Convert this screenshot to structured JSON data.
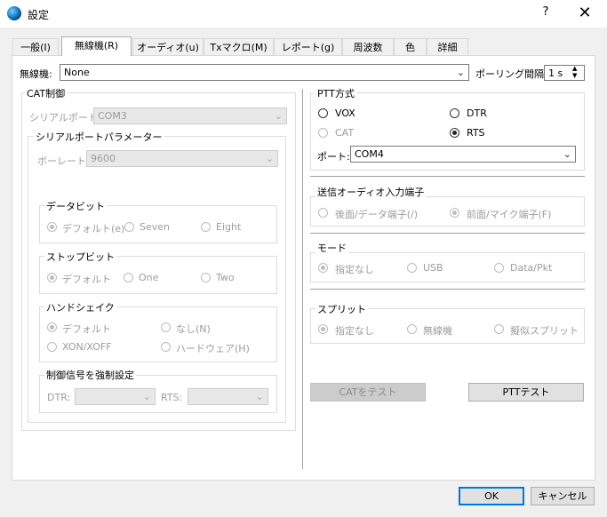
{
  "window": {
    "title": "設定",
    "help": "?",
    "close": "✕"
  },
  "tabs": [
    "一般(I)",
    "無線機(R)",
    "オーディオ(u)",
    "Txマクロ(M)",
    "レポート(g)",
    "周波数",
    "色",
    "詳細"
  ],
  "active_tab": 1,
  "radio_select": {
    "label": "無線機:",
    "value": "None"
  },
  "polling": {
    "label": "ポーリング間隔:",
    "value": "1 s"
  },
  "cat": {
    "title": "CAT制御",
    "serial_port_label": "シリアルポート:",
    "serial_port_value": "COM3",
    "params": {
      "title": "シリアルポートパラメーター",
      "baud_label": "ボーレート:",
      "baud_value": "9600",
      "data_bits": {
        "title": "データビット",
        "options": [
          "デフォルト(e)",
          "Seven",
          "Eight"
        ]
      },
      "stop_bits": {
        "title": "ストップビット",
        "options": [
          "デフォルト",
          "One",
          "Two"
        ]
      },
      "handshake": {
        "title": "ハンドシェイク",
        "options": [
          "デフォルト",
          "なし(N)",
          "XON/XOFF",
          "ハードウェア(H)"
        ]
      },
      "force": {
        "title": "制御信号を強制設定",
        "dtr_label": "DTR:",
        "rts_label": "RTS:"
      }
    }
  },
  "ptt": {
    "title": "PTT方式",
    "options": [
      "VOX",
      "DTR",
      "CAT",
      "RTS"
    ],
    "selected": "RTS",
    "port_label": "ポート:",
    "port_value": "COM4"
  },
  "audio_in": {
    "title": "送信オーディオ入力端子",
    "options": [
      "後面/データ端子(/)",
      "前面/マイク端子(F)"
    ]
  },
  "mode": {
    "title": "モード",
    "options": [
      "指定なし",
      "USB",
      "Data/Pkt"
    ]
  },
  "split": {
    "title": "スプリット",
    "options": [
      "指定なし",
      "無線機",
      "擬似スプリット"
    ]
  },
  "buttons": {
    "test_cat": "CATをテスト",
    "test_ptt": "PTTテスト",
    "ok": "OK",
    "cancel": "キャンセル"
  }
}
